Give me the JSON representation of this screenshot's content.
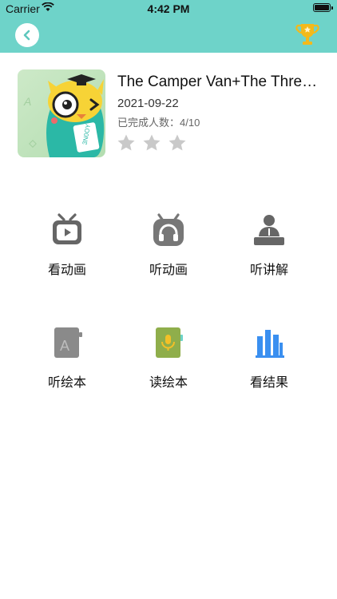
{
  "status_bar": {
    "carrier": "Carrier",
    "time": "4:42 PM"
  },
  "header": {
    "back_icon": "chevron-left-icon",
    "trophy_icon": "trophy-icon",
    "background_color": "#6ed3c9"
  },
  "book": {
    "title": "The Camper Van+The Three...",
    "date": "2021-09-22",
    "progress_label": "已完成人数：4/10",
    "rating": 0,
    "rating_max": 3,
    "cover_text": "3N0OY"
  },
  "actions": [
    {
      "label": "看动画",
      "icon": "tv-icon"
    },
    {
      "label": "听动画",
      "icon": "headphones-icon"
    },
    {
      "label": "听讲解",
      "icon": "teacher-icon"
    },
    {
      "label": "听绘本",
      "icon": "book-a-icon"
    },
    {
      "label": "读绘本",
      "icon": "microphone-book-icon"
    },
    {
      "label": "看结果",
      "icon": "bar-chart-icon"
    }
  ]
}
